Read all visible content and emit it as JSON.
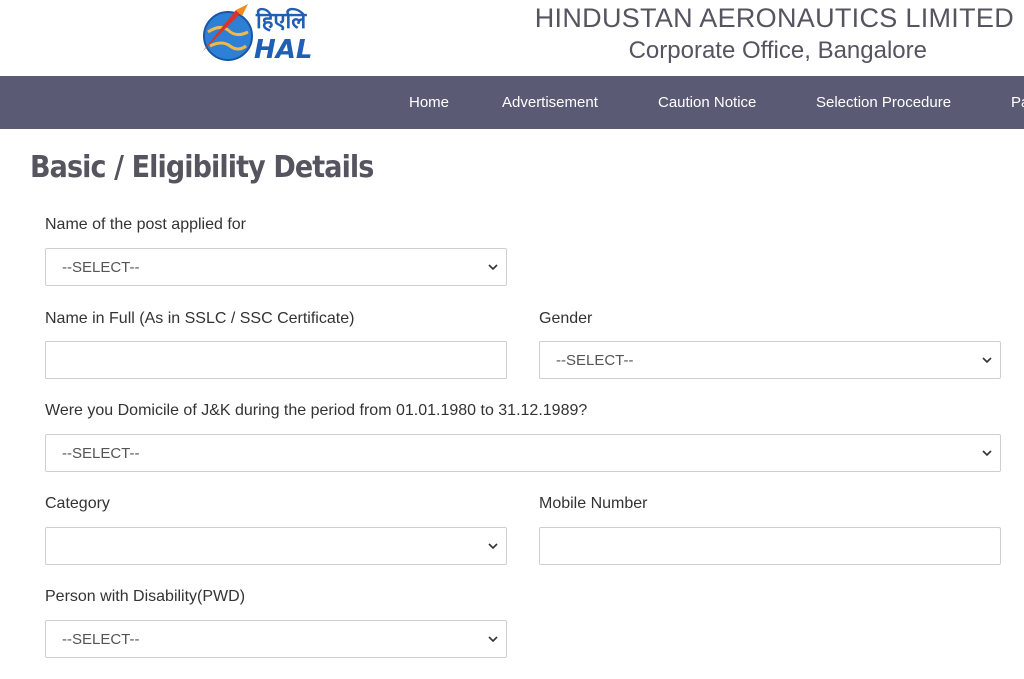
{
  "header": {
    "logo_hindi": "हिएलि",
    "logo_text": "HAL",
    "title": "HINDUSTAN AERONAUTICS LIMITED",
    "subtitle": "Corporate Office, Bangalore"
  },
  "nav": {
    "items": [
      "Home",
      "Advertisement",
      "Caution Notice",
      "Selection Procedure",
      "Pa"
    ]
  },
  "page": {
    "title": "Basic / Eligibility Details"
  },
  "form": {
    "post": {
      "label": "Name of the post applied for",
      "value": "--SELECT--"
    },
    "full_name": {
      "label": "Name in Full (As in SSLC / SSC Certificate)",
      "value": ""
    },
    "gender": {
      "label": "Gender",
      "value": "--SELECT--"
    },
    "domicile": {
      "label": "Were you Domicile of J&K during the period from 01.01.1980 to 31.12.1989?",
      "value": "--SELECT--"
    },
    "category": {
      "label": "Category",
      "value": ""
    },
    "mobile": {
      "label": "Mobile Number",
      "value": ""
    },
    "pwd": {
      "label": "Person with Disability(PWD)",
      "value": "--SELECT--"
    }
  },
  "colors": {
    "nav_bg": "#5a5a75",
    "title_text": "#55545f",
    "logo_blue": "#1f5fb5",
    "logo_red": "#d8352a"
  },
  "icons": {
    "select_arrow": "chevron-down-icon"
  }
}
